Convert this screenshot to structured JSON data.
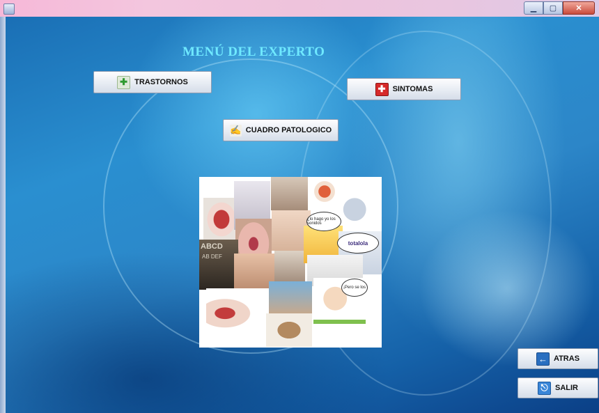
{
  "window": {
    "title": "",
    "controls": [
      "minimize",
      "maximize",
      "close"
    ]
  },
  "main": {
    "title": "MENÚ DEL EXPERTO",
    "buttons": {
      "trastornos": {
        "label": "TRASTORNOS",
        "icon": "green-cross-icon"
      },
      "sintomas": {
        "label": "SINTOMAS",
        "icon": "first-aid-kit-icon"
      },
      "cuadro": {
        "label": "CUADRO PATOLOGICO",
        "icon": "writing-hand-icon"
      },
      "atras": {
        "label": "ATRAS",
        "icon": "arrow-left-icon"
      },
      "salir": {
        "label": "SALIR",
        "icon": "exit-door-icon"
      }
    },
    "collage": {
      "bubble_text_1": "totalola",
      "bubble_text_2": "¿lo hago yo los sonidos",
      "bubble_text_3": "¡Pero se los",
      "label_1": "ABCD",
      "label_2": "AB DEF"
    }
  },
  "colors": {
    "title": "#6fe9ff",
    "background": "#1f7dc2",
    "titlebar": "#f3c6de"
  }
}
